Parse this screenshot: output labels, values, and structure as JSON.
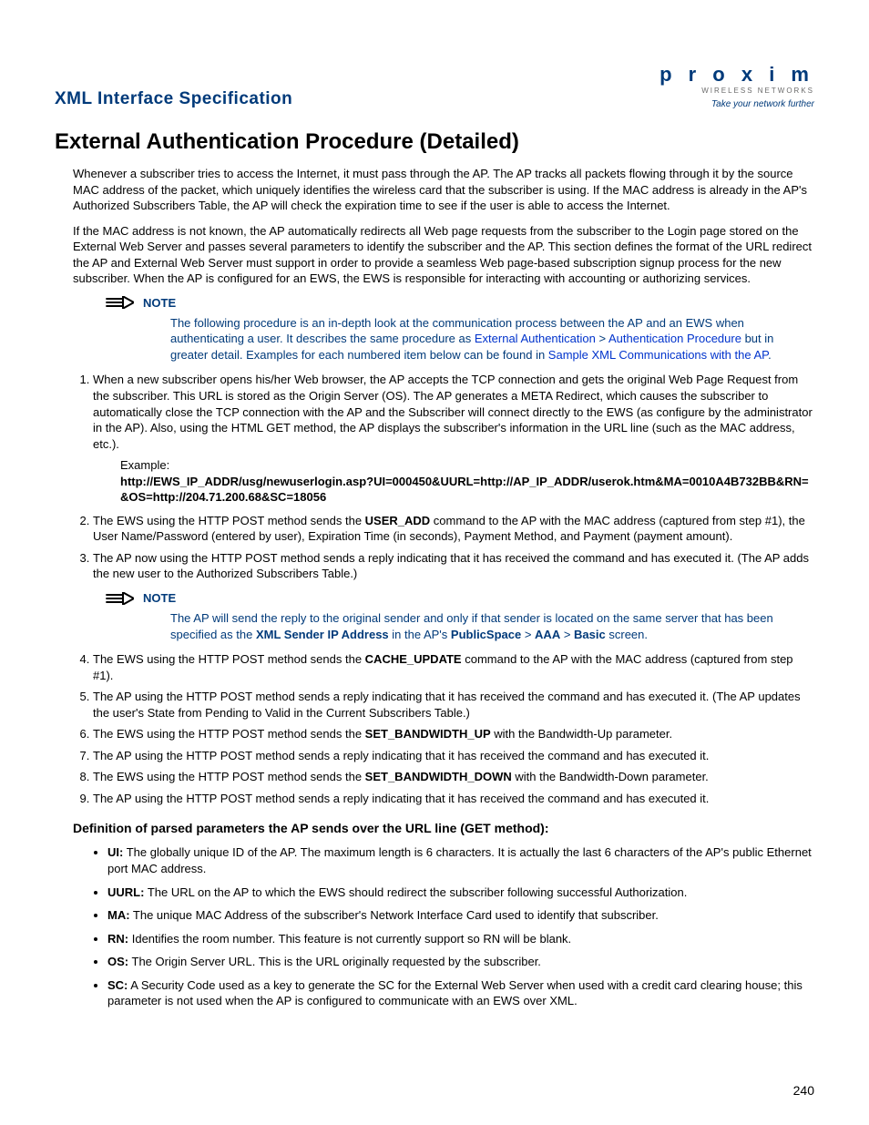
{
  "header": {
    "section_title": "XML Interface Specification",
    "logo_main": "p r o x i m",
    "logo_sub": "WIRELESS NETWORKS",
    "logo_tag": "Take your network further"
  },
  "title": "External Authentication Procedure (Detailed)",
  "intro_p1": "Whenever a subscriber tries to access the Internet, it must pass through the AP. The AP tracks all packets flowing through it by the source MAC address of the packet, which uniquely identifies the wireless card that the subscriber is using. If the MAC address is already in the AP's Authorized Subscribers Table, the AP will check the expiration time to see if the user is able to access the Internet.",
  "intro_p2": "If the MAC address is not known, the AP automatically redirects all Web page requests from the subscriber to the Login page stored on the External Web Server and passes several parameters to identify the subscriber and the AP. This section defines the format of the URL redirect the AP and External Web Server must support in order to provide a seamless Web page-based subscription signup process for the new subscriber. When the AP is configured for an EWS, the EWS is responsible for interacting with accounting or authorizing services.",
  "note1": {
    "label": "NOTE",
    "pre": "The following procedure is an in-depth look at the communication process between the AP and an EWS when authenticating a user. It describes the same procedure as ",
    "link1": "External Authentication",
    "sep": " > ",
    "link2": "Authentication Procedure",
    "post": " but in greater detail. Examples for each numbered item below can be found in ",
    "link3": "Sample XML Communications with the AP",
    "end": "."
  },
  "step1": "When a new subscriber opens his/her Web browser, the AP accepts the TCP connection and gets the original Web Page Request from the subscriber. This URL is stored as the Origin Server (OS). The AP generates a META Redirect, which causes the subscriber to automatically close the TCP connection with the AP and the Subscriber will connect directly to the EWS (as configure by the administrator in the AP). Also, using the HTML GET method, the AP displays the subscriber's information in the URL line (such as the MAC address, etc.).",
  "example_label": "Example:",
  "example_url": "http://EWS_IP_ADDR/usg/newuserlogin.asp?UI=000450&UURL=http://AP_IP_ADDR/userok.htm&MA=0010A4B732BB&RN=&OS=http://204.71.200.68&SC=18056",
  "step2_pre": "The EWS using the HTTP POST method sends the ",
  "step2_cmd": "USER_ADD",
  "step2_post": " command to the AP with the MAC address (captured from step #1), the User Name/Password (entered by user), Expiration Time (in seconds), Payment Method, and Payment (payment amount).",
  "step3": "The AP now using the HTTP POST method sends a reply indicating that it has received the command and has executed it. (The AP adds the new user to the Authorized Subscribers Table.)",
  "note2": {
    "label": "NOTE",
    "pre": "The AP will send the reply to the original sender and only if that sender is located on the same server that has been specified as the ",
    "b1": "XML Sender IP Address",
    "mid1": " in the AP's ",
    "b2": "PublicSpace",
    "sep1": " > ",
    "b3": "AAA",
    "sep2": " > ",
    "b4": "Basic",
    "end": " screen."
  },
  "step4_pre": "The EWS using the HTTP POST method sends the ",
  "step4_cmd": "CACHE_UPDATE",
  "step4_post": " command to the AP with the MAC address (captured from step #1).",
  "step5": "The AP using the HTTP POST method sends a reply indicating that it has received the command and has executed it. (The AP updates the user's State from Pending to Valid in the Current Subscribers Table.)",
  "step6_pre": "The EWS using the HTTP POST method sends the ",
  "step6_cmd": "SET_BANDWIDTH_UP",
  "step6_post": " with the Bandwidth-Up parameter.",
  "step7": "The AP using the HTTP POST method sends a reply indicating that it has received the command and has executed it.",
  "step8_pre": "The EWS using the HTTP POST method sends the ",
  "step8_cmd": "SET_BANDWIDTH_DOWN",
  "step8_post": " with the Bandwidth-Down parameter.",
  "step9": "The AP using the HTTP POST method sends a reply indicating that it has received the command and has executed it.",
  "subhead": "Definition of parsed parameters the AP sends over the URL line (GET method):",
  "params": {
    "ui_l": "UI:",
    "ui": " The globally unique ID of the AP.   The maximum length is 6 characters. It is actually the last 6 characters of the AP's public Ethernet port MAC address.",
    "uurl_l": "UURL:",
    "uurl": " The URL on the AP to which the EWS should redirect the subscriber following successful Authorization.",
    "ma_l": "MA:",
    "ma": " The unique MAC Address of the subscriber's Network Interface Card used to identify that subscriber.",
    "rn_l": "RN:",
    "rn": " Identifies the room number. This feature is not currently support so RN will be blank.",
    "os_l": "OS:",
    "os": " The Origin Server URL. This is the URL originally requested by the subscriber.",
    "sc_l": "SC:",
    "sc": " A Security Code used as a key to generate the SC for the External Web Server when used with a credit card clearing house; this parameter is not used when the AP is configured to communicate with an EWS over XML."
  },
  "page_number": "240"
}
